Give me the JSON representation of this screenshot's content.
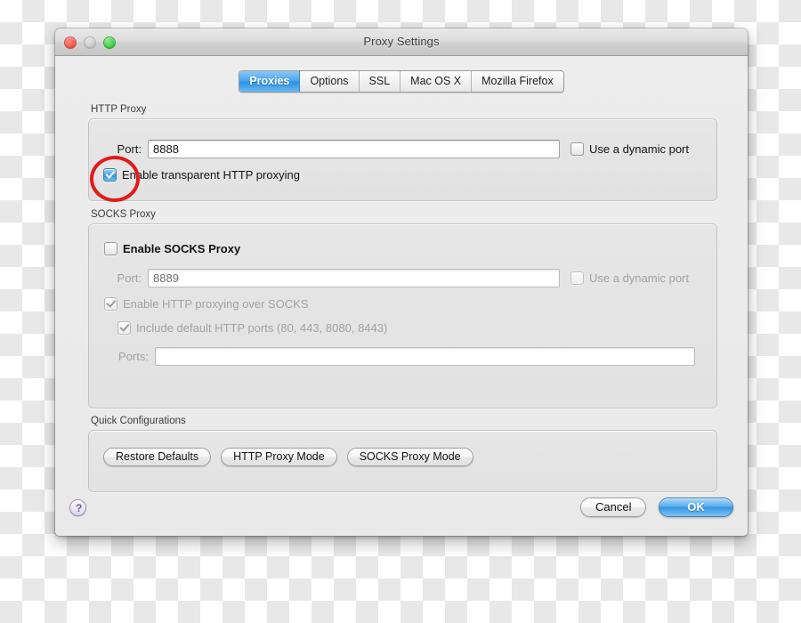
{
  "window": {
    "title": "Proxy Settings",
    "traffic_lights": [
      {
        "name": "close",
        "color": "#f2554c"
      },
      {
        "name": "minimize",
        "color": "#c9c9c9"
      },
      {
        "name": "zoom",
        "color": "#39cc43"
      }
    ]
  },
  "tabs": [
    {
      "label": "Proxies",
      "active": true
    },
    {
      "label": "Options",
      "active": false
    },
    {
      "label": "SSL",
      "active": false
    },
    {
      "label": "Mac OS X",
      "active": false
    },
    {
      "label": "Mozilla Firefox",
      "active": false
    }
  ],
  "http_proxy": {
    "group_label": "HTTP Proxy",
    "port_label": "Port:",
    "port_value": "8888",
    "dynamic_port_label": "Use a dynamic port",
    "dynamic_port_checked": false,
    "transparent_label": "Enable transparent HTTP proxying",
    "transparent_checked": true
  },
  "socks_proxy": {
    "group_label": "SOCKS Proxy",
    "enable_label": "Enable SOCKS Proxy",
    "enable_checked": false,
    "port_label": "Port:",
    "port_value": "8889",
    "dynamic_port_label": "Use a dynamic port",
    "dynamic_port_checked": false,
    "http_over_socks_label": "Enable HTTP proxying over SOCKS",
    "http_over_socks_checked": true,
    "default_ports_label": "Include default HTTP ports (80, 443, 8080, 8443)",
    "default_ports_checked": true,
    "ports_label": "Ports:",
    "ports_value": "",
    "ports_placeholder": ""
  },
  "quick_configurations": {
    "group_label": "Quick Configurations",
    "buttons": [
      {
        "label": "Restore Defaults"
      },
      {
        "label": "HTTP Proxy Mode"
      },
      {
        "label": "SOCKS Proxy Mode"
      }
    ]
  },
  "footer": {
    "help_label": "?",
    "cancel_label": "Cancel",
    "ok_label": "OK"
  },
  "annotation": {
    "shape": "ellipse",
    "color": "#e01b1b",
    "target": "enable-transparent-http-proxying-checkbox"
  }
}
